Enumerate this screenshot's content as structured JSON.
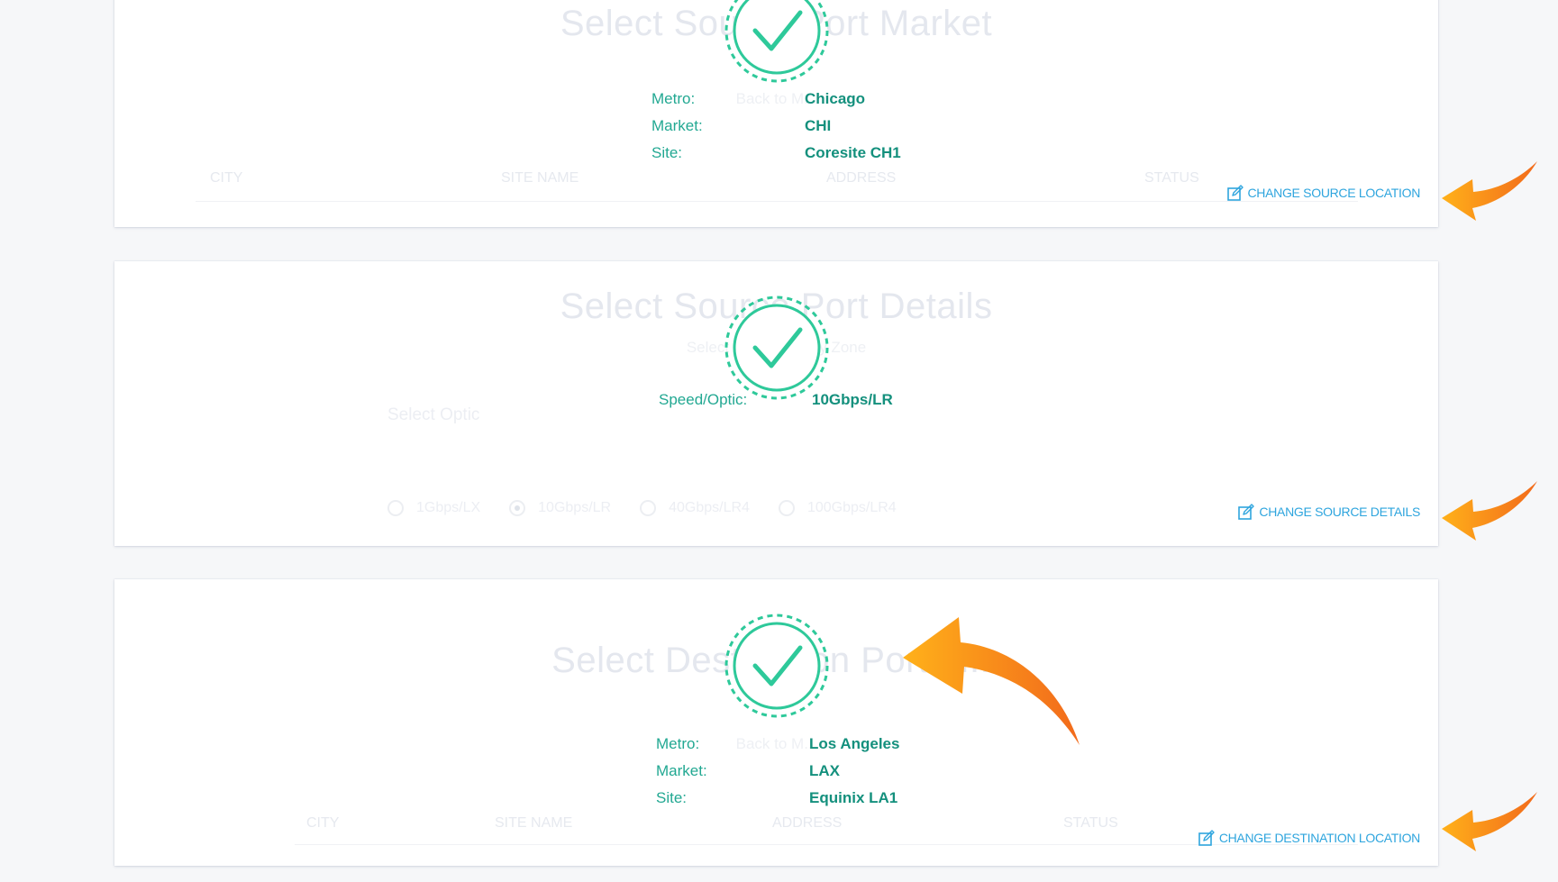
{
  "source_market": {
    "title": "Select Source Port Market",
    "subtitle": "Back to M...",
    "columns": [
      "CITY",
      "SITE NAME",
      "ADDRESS",
      "STATUS"
    ],
    "summary": [
      {
        "label": "Metro:",
        "value": "Chicago"
      },
      {
        "label": "Market:",
        "value": "CHI"
      },
      {
        "label": "Site:",
        "value": "Coresite CH1"
      }
    ],
    "change_label": "CHANGE SOURCE LOCATION"
  },
  "source_details": {
    "title": "Select Source Port Details",
    "subtitle": "Select Opt... ...ability Zone",
    "optic_label": "Select Optic",
    "optics": [
      "1Gbps/LX",
      "10Gbps/LR",
      "40Gbps/LR4",
      "100Gbps/LR4"
    ],
    "selected_optic": "10Gbps/LR",
    "summary": [
      {
        "label": "Speed/Optic:",
        "value": "10Gbps/LR"
      }
    ],
    "change_label": "CHANGE SOURCE DETAILS"
  },
  "destination_market": {
    "title": "Select Destination Port M...",
    "subtitle": "Back to M...",
    "columns": [
      "CITY",
      "SITE NAME",
      "ADDRESS",
      "STATUS"
    ],
    "summary": [
      {
        "label": "Metro:",
        "value": "Los Angeles"
      },
      {
        "label": "Market:",
        "value": "LAX"
      },
      {
        "label": "Site:",
        "value": "Equinix LA1"
      }
    ],
    "change_label": "CHANGE DESTINATION LOCATION"
  },
  "colors": {
    "accent_green": "#2ec99a",
    "link_blue": "#2ea5de",
    "arrow_orange": "#f7931e"
  },
  "icons": [
    "check-circle-icon",
    "edit-icon",
    "orange-arrow-icon"
  ]
}
